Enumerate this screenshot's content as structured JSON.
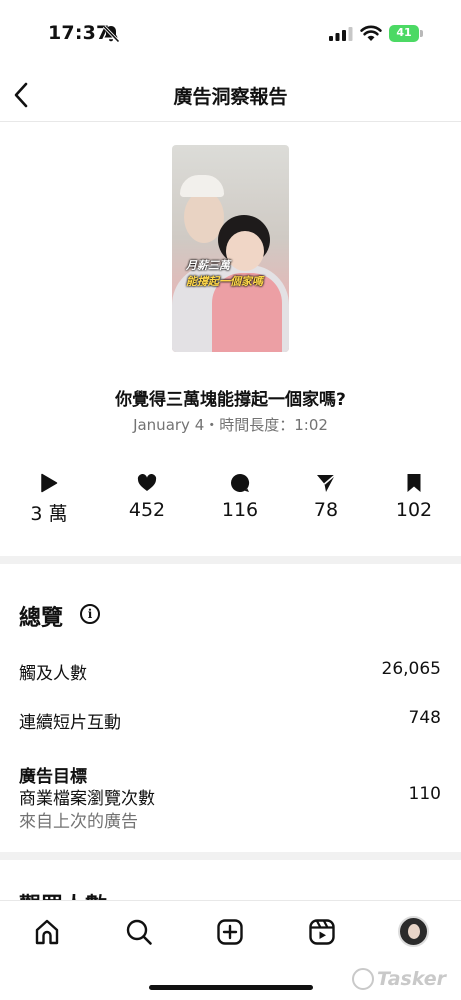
{
  "status_bar": {
    "time": "17:37",
    "battery": "41"
  },
  "header": {
    "title": "廣告洞察報告"
  },
  "post": {
    "thumbnail_caption_1": "月薪三萬",
    "thumbnail_caption_2": "能撐起一個家嗎",
    "title": "你覺得三萬塊能撐起一個家嗎?",
    "meta": "January 4・時間長度：1:02"
  },
  "stats": [
    {
      "icon": "play-icon",
      "value": "3 萬"
    },
    {
      "icon": "heart-icon",
      "value": "452"
    },
    {
      "icon": "comment-icon",
      "value": "116"
    },
    {
      "icon": "share-icon",
      "value": "78"
    },
    {
      "icon": "bookmark-icon",
      "value": "102"
    }
  ],
  "overview": {
    "title": "總覽",
    "reach_label": "觸及人數",
    "reach_value": "26,065",
    "interactions_label": "連續短片互動",
    "interactions_value": "748",
    "ad_goal_heading": "廣告目標",
    "profile_visits_label": "商業檔案瀏覽次數",
    "profile_visits_value": "110",
    "profile_visits_sub": "來自上次的廣告"
  },
  "next_section": {
    "title_partial": "觀眾人數"
  },
  "bottom_nav": [
    "home-icon",
    "search-icon",
    "create-icon",
    "reels-icon",
    "profile-avatar"
  ],
  "watermark": "Tasker",
  "colors": {
    "battery": "#4cd964",
    "muted_text": "#737373",
    "divider": "#f1f1f1"
  }
}
